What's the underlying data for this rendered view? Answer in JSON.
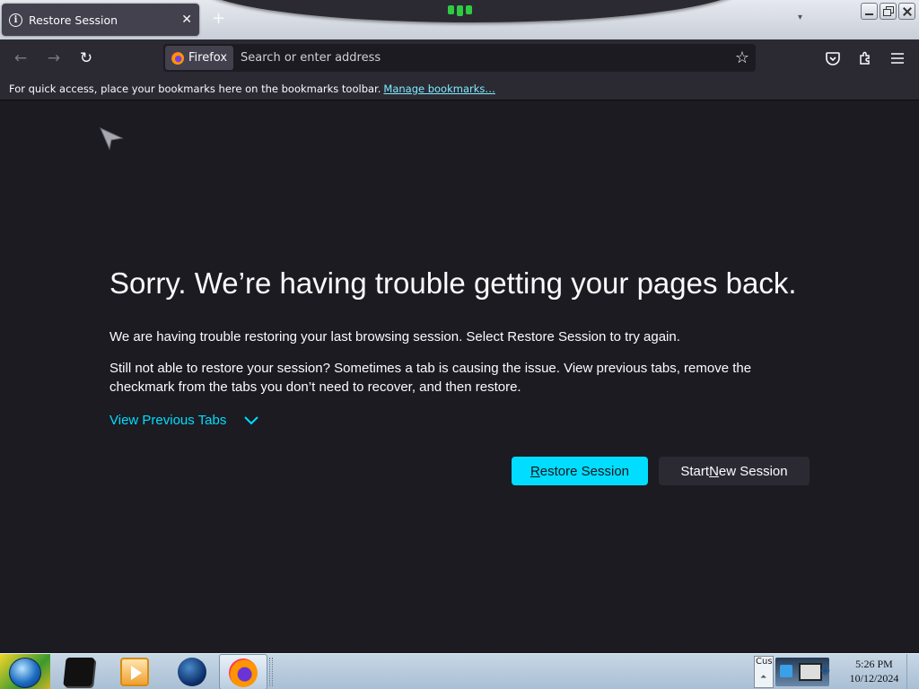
{
  "tab": {
    "title": "Restore Session",
    "close_glyph": "✕",
    "new_tab_glyph": "+",
    "icon": "info-icon"
  },
  "window_controls": [
    "minimize",
    "restore",
    "close"
  ],
  "navbar": {
    "back_glyph": "←",
    "forward_glyph": "→",
    "reload_glyph": "↻",
    "identity_label": "Firefox",
    "url_placeholder": "Search or enter address",
    "star_glyph": "☆"
  },
  "bookmarks_bar": {
    "text": "For quick access, place your bookmarks here on the bookmarks toolbar.",
    "link": "Manage bookmarks…"
  },
  "content": {
    "title": "Sorry. We’re having trouble getting your pages back.",
    "paragraph1": "We are having trouble restoring your last browsing session. Select Restore Session to try again.",
    "paragraph2": "Still not able to restore your session? Sometimes a tab is causing the issue. View previous tabs, remove the checkmark from the tabs you don’t need to recover, and then restore.",
    "view_previous_tabs": "View Previous Tabs",
    "restore_button": {
      "prefix": "",
      "accesskey": "R",
      "suffix": "estore Session"
    },
    "new_session_button": {
      "prefix": "Start ",
      "accesskey": "N",
      "suffix": "ew Session"
    }
  },
  "taskbar": {
    "tray_text": "Cus",
    "time": "5:26 PM",
    "date": "10/12/2024"
  },
  "colors": {
    "accent": "#00ddff",
    "page_bg": "#1c1b22",
    "toolbar_bg": "#2b2a33",
    "link": "#80ebff"
  }
}
